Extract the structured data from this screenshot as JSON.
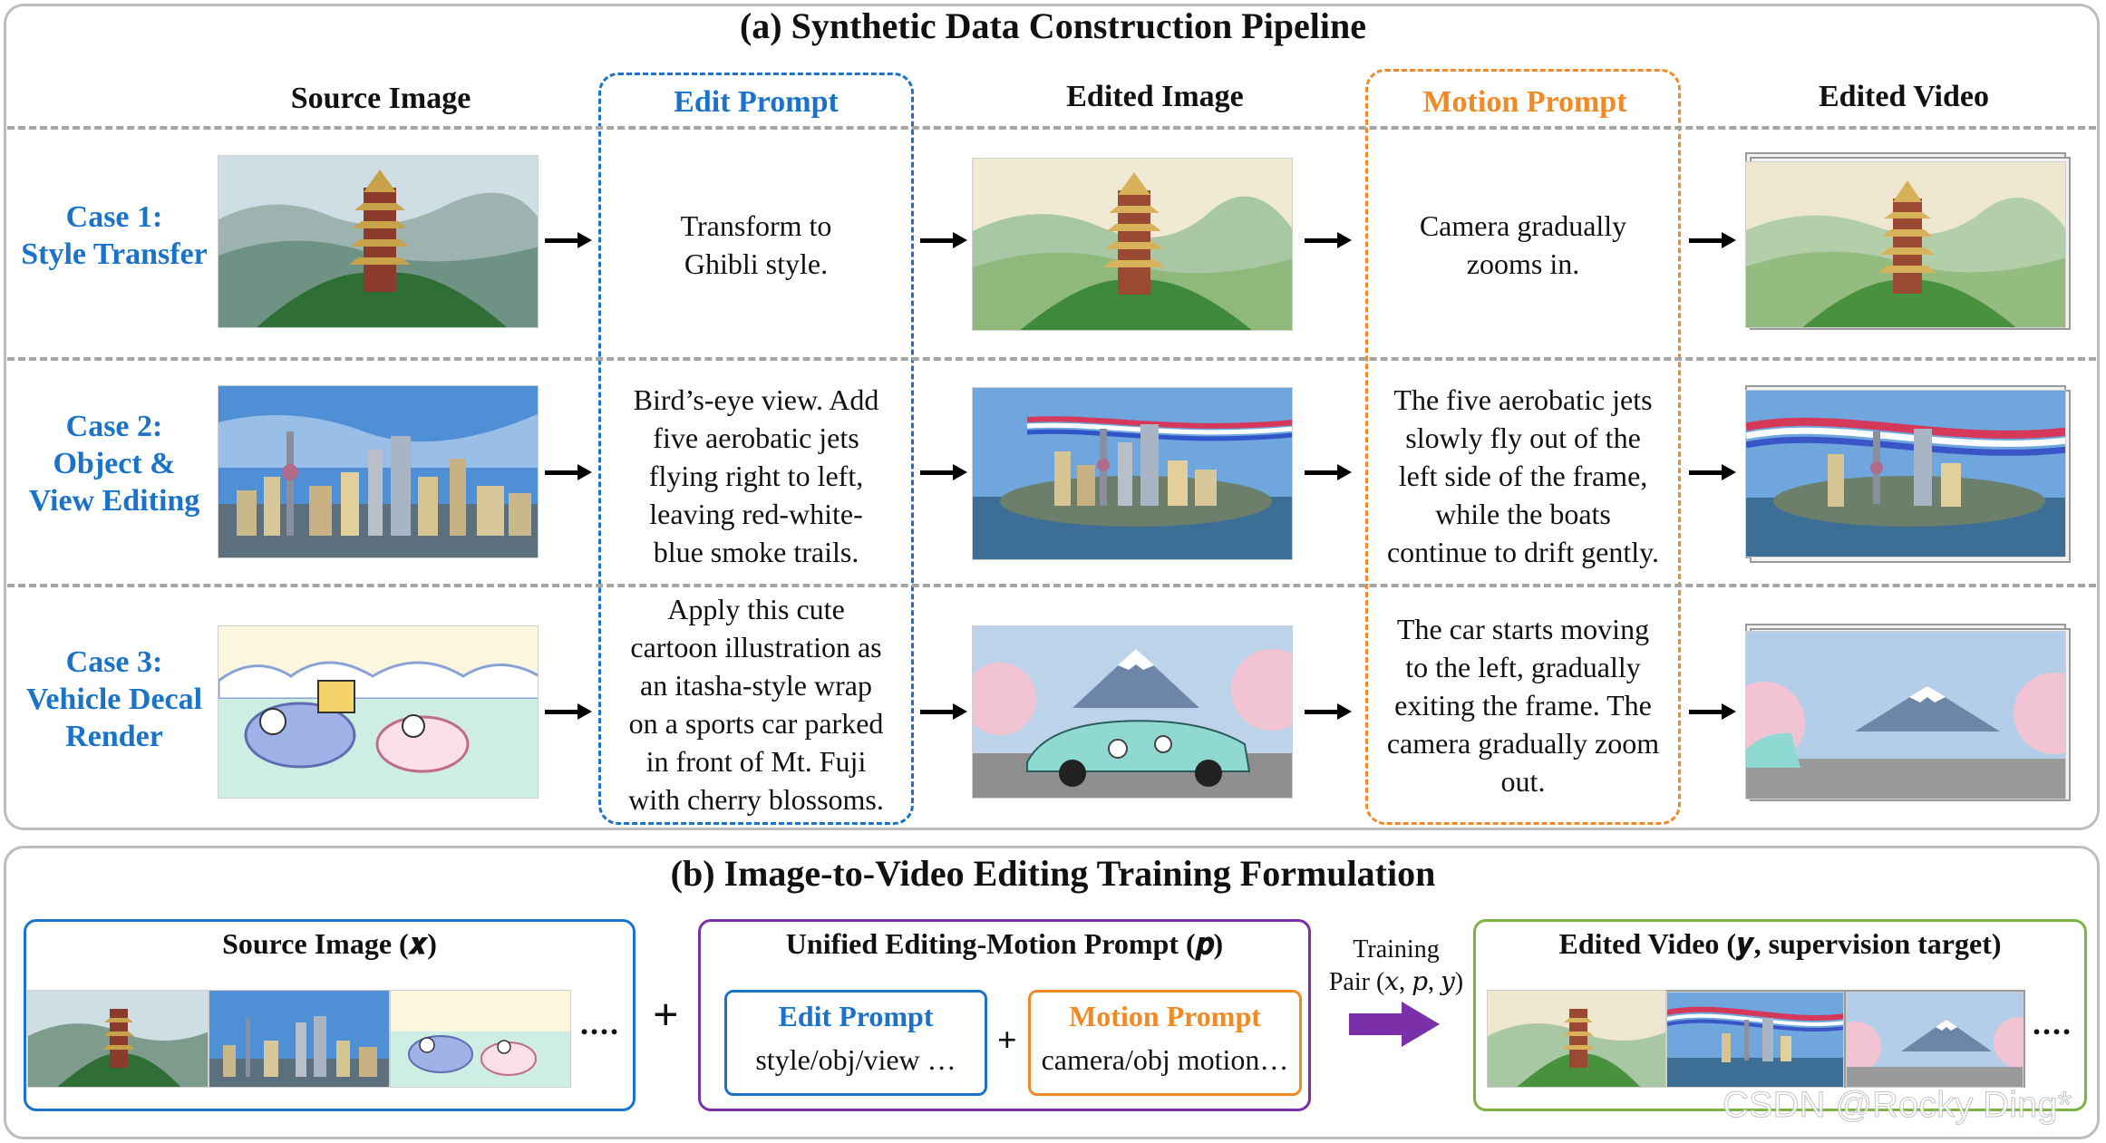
{
  "section_a": {
    "title": "(a) Synthetic Data Construction Pipeline",
    "columns": {
      "source_image": "Source Image",
      "edit_prompt": "Edit Prompt",
      "edited_image": "Edited Image",
      "motion_prompt": "Motion Prompt",
      "edited_video": "Edited Video"
    },
    "cases": [
      {
        "label_lines": [
          "Case 1:",
          "Style Transfer"
        ],
        "edit_prompt_lines": [
          "Transform to",
          "Ghibli style."
        ],
        "motion_prompt_lines": [
          "Camera gradually",
          "zooms in."
        ]
      },
      {
        "label_lines": [
          "Case 2:",
          "Object &",
          "View Editing"
        ],
        "edit_prompt_lines": [
          "Bird’s-eye view. Add",
          "five aerobatic jets",
          "flying right to left,",
          "leaving red-white-",
          "blue smoke trails."
        ],
        "motion_prompt_lines": [
          "The five aerobatic jets",
          "slowly fly out of the",
          "left side of the frame,",
          "while the boats",
          "continue to drift gently."
        ]
      },
      {
        "label_lines": [
          "Case 3:",
          "Vehicle Decal",
          "Render"
        ],
        "edit_prompt_lines": [
          "Apply this cute",
          "cartoon illustration as",
          "an itasha-style wrap",
          "on a sports car parked",
          "in front of Mt. Fuji",
          "with cherry blossoms."
        ],
        "motion_prompt_lines": [
          "The car starts moving",
          "to the left, gradually",
          "exiting the frame. The",
          "camera gradually zoom",
          "out."
        ]
      }
    ]
  },
  "section_b": {
    "title": "(b) Image-to-Video Editing Training Formulation",
    "source_box": {
      "title": "Source Image (𝒙)",
      "ellipsis": "...."
    },
    "plus": "+",
    "prompt_box": {
      "title": "Unified Editing-Motion Prompt (𝒑)",
      "edit_title": "Edit Prompt",
      "edit_text": "style/obj/view …",
      "plus": "+",
      "motion_title": "Motion Prompt",
      "motion_text": "camera/obj motion…"
    },
    "training_pair": {
      "line1": "Training",
      "line2": "Pair (𝑥, 𝑝, 𝑦)"
    },
    "video_box": {
      "title": "Edited Video (𝒚, supervision target)",
      "ellipsis": "...."
    }
  },
  "watermark": "CSDN @Rocky Ding*",
  "colors": {
    "blue": "#1a73c8",
    "orange": "#f08a24",
    "purple": "#7b2fa8",
    "green": "#7cb342",
    "panel_border": "#bdbdbd"
  }
}
